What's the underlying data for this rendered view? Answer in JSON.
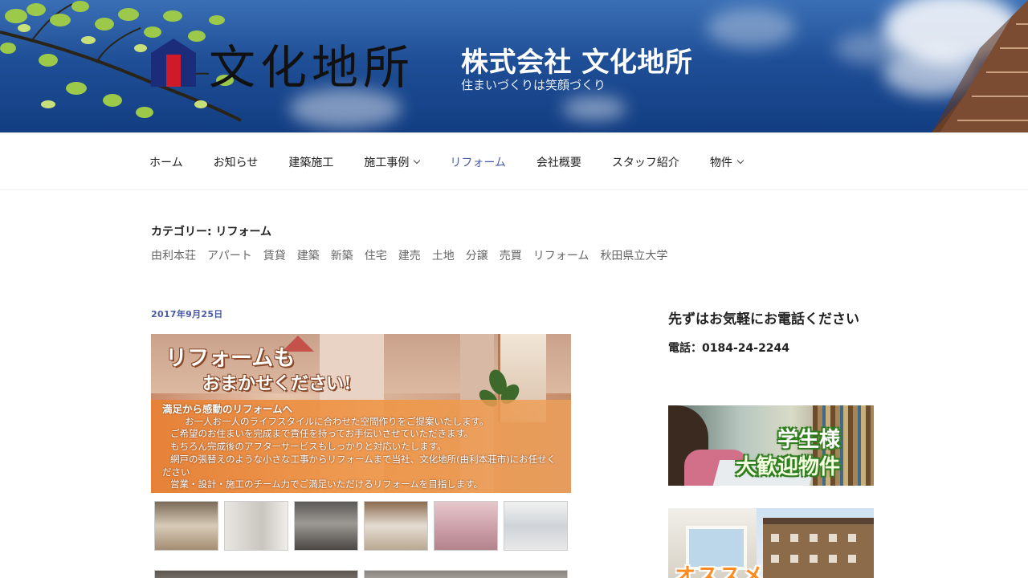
{
  "header": {
    "logo_text": "文化地所",
    "site_title": "株式会社 文化地所",
    "site_description": "住まいづくりは笑顔づくり"
  },
  "nav": {
    "items": [
      {
        "label": "ホーム",
        "dropdown": false,
        "active": false
      },
      {
        "label": "お知らせ",
        "dropdown": false,
        "active": false
      },
      {
        "label": "建築施工",
        "dropdown": false,
        "active": false
      },
      {
        "label": "施工事例",
        "dropdown": true,
        "active": false
      },
      {
        "label": "リフォーム",
        "dropdown": false,
        "active": true
      },
      {
        "label": "会社概要",
        "dropdown": false,
        "active": false
      },
      {
        "label": "スタッフ紹介",
        "dropdown": false,
        "active": false
      },
      {
        "label": "物件",
        "dropdown": true,
        "active": false
      }
    ]
  },
  "archive": {
    "title": "カテゴリー: リフォーム",
    "tags": [
      "由利本荘",
      "アパート",
      "賃貸",
      "建築",
      "新築",
      "住宅",
      "建売",
      "土地",
      "分譲",
      "売買",
      "リフォーム",
      "秋田県立大学"
    ]
  },
  "post": {
    "date": "2017年9月25日",
    "banner": {
      "title_line1": "リフォームも",
      "title_line2": "おまかせください!",
      "heading": "満足から感動のリフォームへ",
      "lines": [
        "お一人お一人のライフスタイルに合わせた空間作りをご提案いたします。",
        "ご希望のお住まいを完成まで責任を持ってお手伝いさせていただきます。",
        "もちろん完成後のアフターサービスもしっかりと対応いたします。",
        "網戸の張替えのような小さな工事からリフォームまで当社、文化地所(由利本荘市)にお任せく",
        "ださい",
        "営業・設計・施工のチーム力でご満足いただけるリフォームを目指します。"
      ]
    }
  },
  "sidebar": {
    "widget_title": "先ずはお気軽にお電話ください",
    "phone": "電話：0184-24-2244",
    "ad1": {
      "line1": "学生様",
      "line2": "大歓迎物件"
    },
    "ad2": {
      "text": "オススメ"
    }
  },
  "colors": {
    "accent": "#4a5ba5",
    "header_sky": "#1f4f97",
    "banner_orange": "#e88134"
  }
}
